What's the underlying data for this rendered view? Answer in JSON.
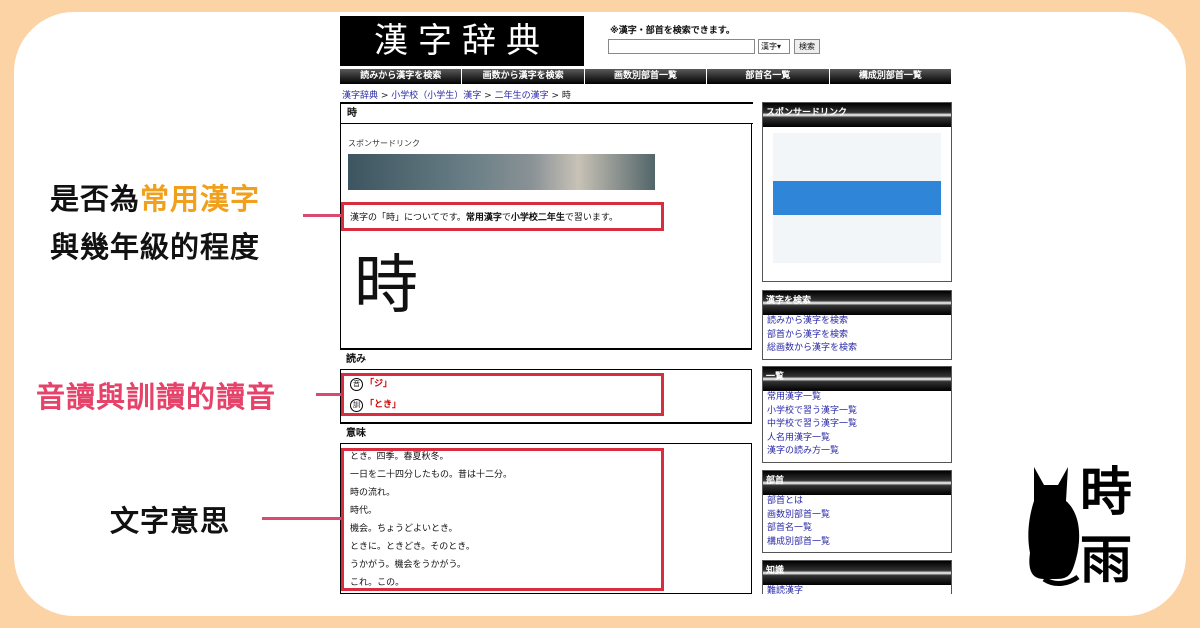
{
  "site": {
    "logo": "漢字辞典",
    "search_hint": "※漢字・部首を検索できます。",
    "search_select": "漢字",
    "search_button": "検索",
    "nav": [
      "読みから漢字を検索",
      "画数から漢字を検索",
      "画数別部首一覧",
      "部首名一覧",
      "構成別部首一覧"
    ],
    "breadcrumb": {
      "items": [
        "漢字辞典",
        "小学校（小学生）漢字",
        "二年生の漢字"
      ],
      "sep": " > ",
      "current": "時"
    }
  },
  "entry": {
    "kanji": "時",
    "sponsor_label": "スポンサードリンク",
    "desc_pre": "漢字の「時」についてです。",
    "desc_b1": "常用漢字",
    "desc_mid": "で",
    "desc_b2": "小学校二年生",
    "desc_post": "で習います。",
    "reading_head": "読み",
    "on_tag": "音",
    "on_reading": "「ジ」",
    "kun_tag": "訓",
    "kun_reading": "「とき」",
    "meaning_head": "意味",
    "meanings": [
      "とき。四季。春夏秋冬。",
      "一日を二十四分したもの。昔は十二分。",
      "時の流れ。",
      "時代。",
      "機会。ちょうどよいとき。",
      "ときに。ときどき。そのとき。",
      "うかがう。機会をうかがう。",
      "これ。この。"
    ]
  },
  "sidebar": {
    "sponsor_head": "スポンサードリンク",
    "search": {
      "head": "漢字を検索",
      "links": [
        "読みから漢字を検索",
        "部首から漢字を検索",
        "総画数から漢字を検索"
      ]
    },
    "list": {
      "head": "一覧",
      "links": [
        "常用漢字一覧",
        "小学校で習う漢字一覧",
        "中学校で習う漢字一覧",
        "人名用漢字一覧",
        "漢字の読み方一覧"
      ]
    },
    "radicals": {
      "head": "部首",
      "links": [
        "部首とは",
        "画数別部首一覧",
        "部首名一覧",
        "構成別部首一覧"
      ]
    },
    "knowledge": {
      "head": "知識",
      "links": [
        "難読漢字"
      ]
    }
  },
  "annotations": {
    "joyo_pre": "是否為",
    "joyo_hl": "常用漢字",
    "grade_line": "與幾年級的程度",
    "readings": "音讀與訓讀的讀音",
    "meaning": "文字意思"
  },
  "badge": {
    "char1": "時",
    "char2": "雨"
  },
  "colors": {
    "background": "#fbd3a5",
    "highlight": "#d82c3f",
    "orange": "#f0a01c",
    "pink": "#e5436a"
  }
}
